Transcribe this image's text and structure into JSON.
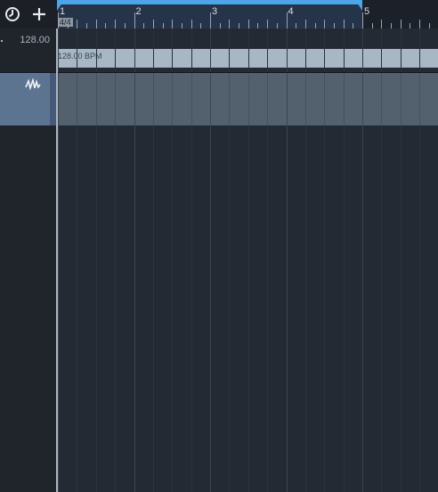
{
  "toolbar": {
    "clock_icon": "clock-icon",
    "add_icon": "plus-icon"
  },
  "ruler": {
    "bars": [
      "1",
      "2",
      "3",
      "4",
      "5"
    ],
    "time_signature": "4/4",
    "loop_start_bar": 1,
    "loop_end_bar": 5
  },
  "tempo_track": {
    "value": "128.00",
    "region_label": "128.00 BPM"
  },
  "audio_track": {
    "icon": "waveform-icon"
  },
  "colors": {
    "loop_accent": "#4aa6e8",
    "track_header": "#5d7490",
    "tempo_region": "#a7b7c4"
  }
}
